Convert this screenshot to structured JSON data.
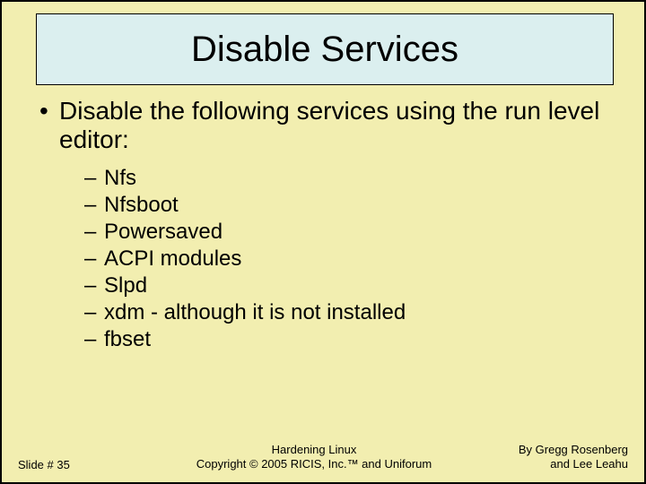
{
  "title": "Disable Services",
  "bullet": "Disable the following services using the run level editor:",
  "items": [
    "Nfs",
    "Nfsboot",
    "Powersaved",
    "ACPI modules",
    "Slpd",
    "xdm - although it is not installed",
    "fbset"
  ],
  "footer": {
    "left": "Slide # 35",
    "center_line1": "Hardening Linux",
    "center_line2": "Copyright © 2005 RICIS, Inc.™ and Uniforum",
    "right_line1": "By Gregg Rosenberg",
    "right_line2": "and Lee Leahu"
  }
}
